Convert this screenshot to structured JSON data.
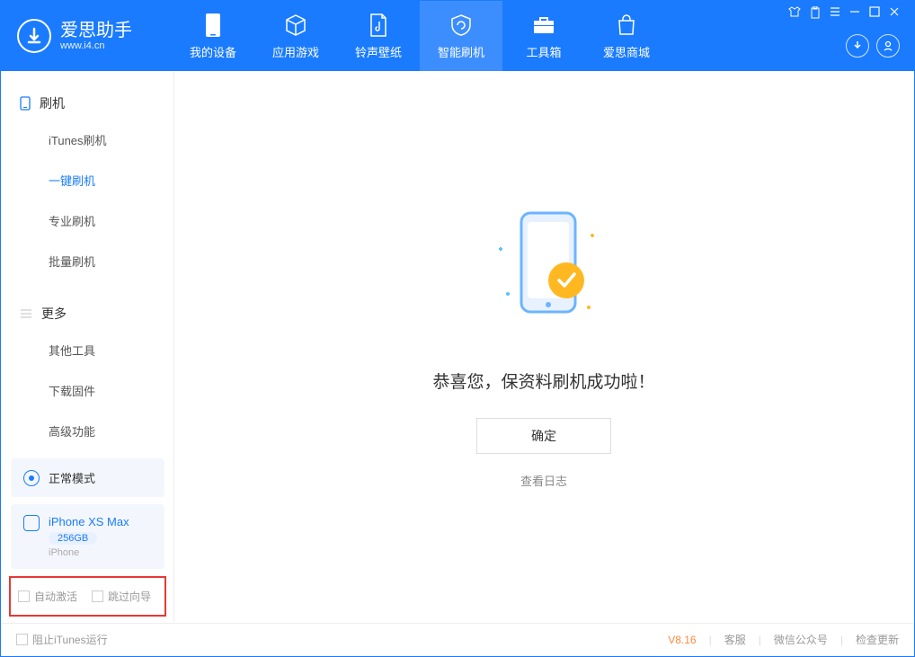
{
  "logo": {
    "title": "爱思助手",
    "subtitle": "www.i4.cn"
  },
  "nav": {
    "tabs": [
      {
        "label": "我的设备"
      },
      {
        "label": "应用游戏"
      },
      {
        "label": "铃声壁纸"
      },
      {
        "label": "智能刷机"
      },
      {
        "label": "工具箱"
      },
      {
        "label": "爱思商城"
      }
    ]
  },
  "sidebar": {
    "section1": {
      "title": "刷机",
      "items": [
        {
          "label": "iTunes刷机"
        },
        {
          "label": "一键刷机"
        },
        {
          "label": "专业刷机"
        },
        {
          "label": "批量刷机"
        }
      ]
    },
    "section2": {
      "title": "更多",
      "items": [
        {
          "label": "其他工具"
        },
        {
          "label": "下载固件"
        },
        {
          "label": "高级功能"
        }
      ]
    },
    "mode_label": "正常模式",
    "device": {
      "name": "iPhone XS Max",
      "storage": "256GB",
      "type": "iPhone"
    },
    "checkbox1": "自动激活",
    "checkbox2": "跳过向导"
  },
  "main": {
    "success_message": "恭喜您，保资料刷机成功啦！",
    "confirm_label": "确定",
    "view_log": "查看日志"
  },
  "footer": {
    "block_itunes": "阻止iTunes运行",
    "version": "V8.16",
    "links": [
      {
        "label": "客服"
      },
      {
        "label": "微信公众号"
      },
      {
        "label": "检查更新"
      }
    ]
  }
}
